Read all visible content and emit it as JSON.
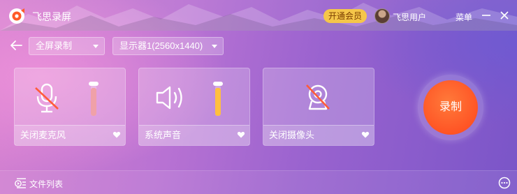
{
  "app": {
    "title": "飞思录屏",
    "vip_label": "开通会员",
    "username": "飞思用户",
    "menu_label": "菜单"
  },
  "toolbar": {
    "mode_selected": "全屏录制",
    "display_selected": "显示器1(2560x1440)"
  },
  "devices": [
    {
      "label": "关闭麦克风",
      "icon": "mic-muted-icon",
      "volume_level": 0.9,
      "level_color": "#f0a1a8"
    },
    {
      "label": "系统声音",
      "icon": "speaker-icon",
      "volume_level": 0.9,
      "level_color": "#ffbf3f"
    },
    {
      "label": "关闭摄像头",
      "icon": "camera-off-icon"
    }
  ],
  "record": {
    "label": "录制"
  },
  "footer": {
    "file_list_label": "文件列表"
  },
  "colors": {
    "accent_orange": "#ff5a28",
    "vip_yellow": "#f5c64a",
    "muted_slash": "#ff5b3a"
  }
}
